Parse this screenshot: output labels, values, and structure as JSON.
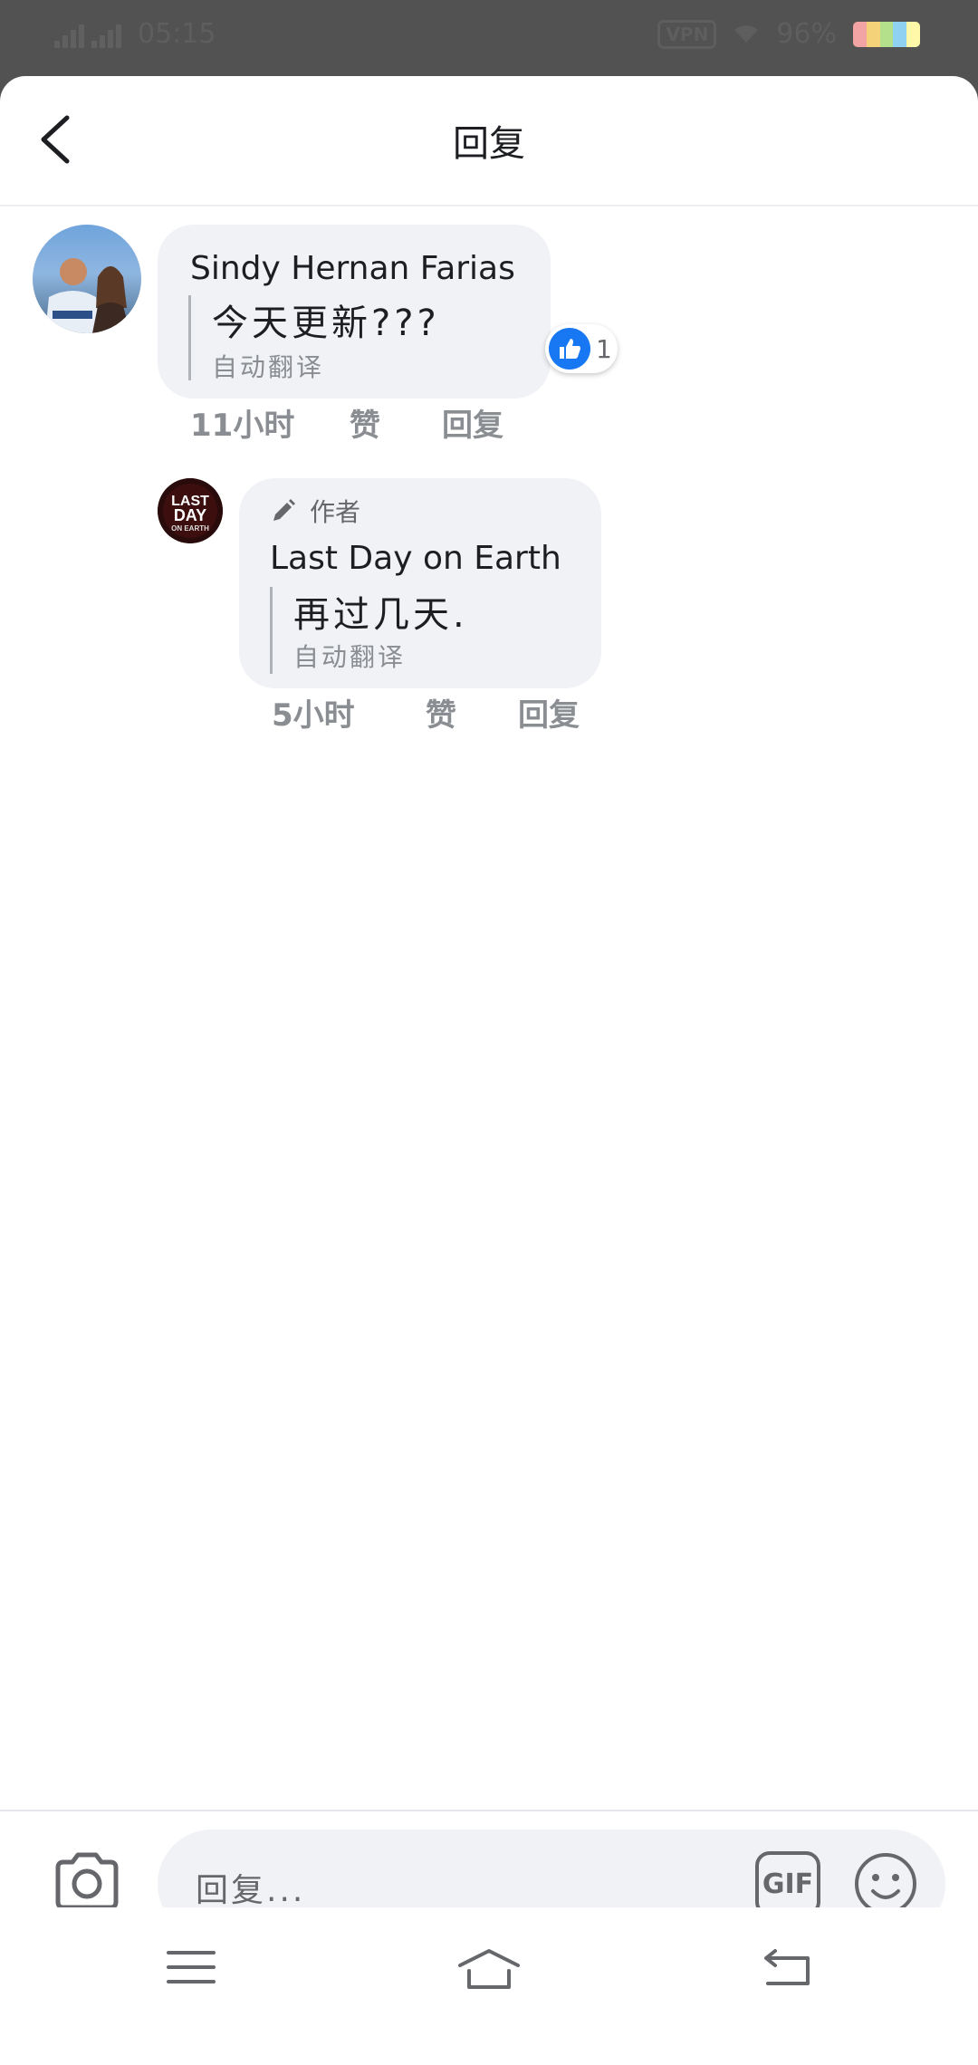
{
  "status_bar": {
    "network": "4G",
    "time": "05:15",
    "vpn": "VPN",
    "battery": "96%"
  },
  "header": {
    "title": "回复"
  },
  "comment": {
    "author": "Sindy Hernan Farias",
    "text": "今天更新???",
    "translate_label": "自动翻译",
    "reaction_count": "1",
    "time": "11小时",
    "like_label": "赞",
    "reply_label": "回复"
  },
  "reply": {
    "role_label": "作者",
    "author": "Last Day on Earth",
    "text": "再过几天.",
    "translate_label": "自动翻译",
    "time": "5小时",
    "like_label": "赞",
    "reply_label": "回复",
    "avatar_lines": [
      "LAST",
      "DAY",
      "ON EARTH"
    ]
  },
  "composer": {
    "placeholder": "回复...",
    "gif_label": "GIF"
  },
  "colors": {
    "like_blue": "#1877f2",
    "bubble_bg": "#f0f2f5",
    "secondary_text": "#8a8d91"
  },
  "icons": [
    "back-arrow-icon",
    "like-icon",
    "pencil-icon",
    "camera-icon",
    "gif-icon",
    "emoji-icon",
    "menu-icon",
    "home-icon",
    "back-nav-icon"
  ]
}
